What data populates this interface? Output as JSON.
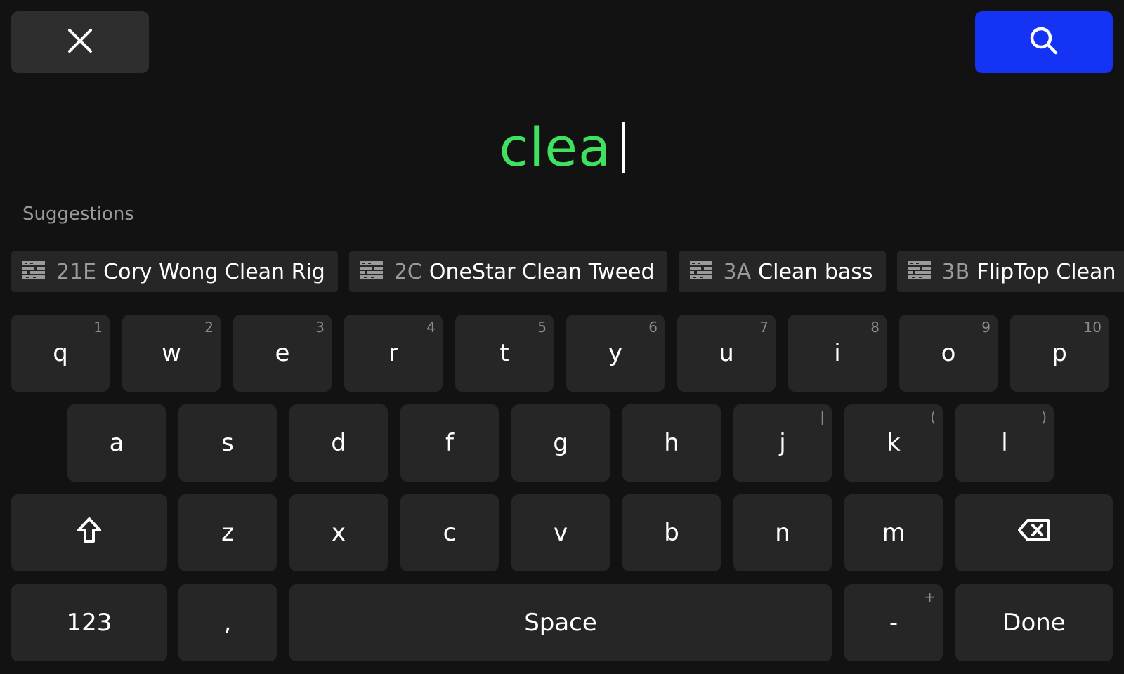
{
  "header": {
    "close_icon": "close-icon",
    "search_icon": "search-icon",
    "search_color": "#1433f5"
  },
  "query": {
    "text": "clea",
    "color": "#3fe15f"
  },
  "suggestions": {
    "label": "Suggestions",
    "items": [
      {
        "code": "21E",
        "name": "Cory Wong Clean Rig",
        "icon": "rig-icon"
      },
      {
        "code": "2C",
        "name": "OneStar Clean Tweed",
        "icon": "rig-icon"
      },
      {
        "code": "3A",
        "name": "Clean bass",
        "icon": "rig-icon"
      },
      {
        "code": "3B",
        "name": "FlipTop Clean",
        "icon": "rig-icon"
      }
    ]
  },
  "keyboard": {
    "row1": [
      {
        "label": "q",
        "hint": "1"
      },
      {
        "label": "w",
        "hint": "2"
      },
      {
        "label": "e",
        "hint": "3"
      },
      {
        "label": "r",
        "hint": "4"
      },
      {
        "label": "t",
        "hint": "5"
      },
      {
        "label": "y",
        "hint": "6"
      },
      {
        "label": "u",
        "hint": "7"
      },
      {
        "label": "i",
        "hint": "8"
      },
      {
        "label": "o",
        "hint": "9"
      },
      {
        "label": "p",
        "hint": "10"
      }
    ],
    "row2": [
      {
        "label": "a",
        "hint": ""
      },
      {
        "label": "s",
        "hint": ""
      },
      {
        "label": "d",
        "hint": ""
      },
      {
        "label": "f",
        "hint": ""
      },
      {
        "label": "g",
        "hint": ""
      },
      {
        "label": "h",
        "hint": ""
      },
      {
        "label": "j",
        "hint": "|"
      },
      {
        "label": "k",
        "hint": "("
      },
      {
        "label": "l",
        "hint": ")"
      }
    ],
    "row3": [
      {
        "label": "z",
        "hint": ""
      },
      {
        "label": "x",
        "hint": ""
      },
      {
        "label": "c",
        "hint": ""
      },
      {
        "label": "v",
        "hint": ""
      },
      {
        "label": "b",
        "hint": ""
      },
      {
        "label": "n",
        "hint": ""
      },
      {
        "label": "m",
        "hint": ""
      }
    ],
    "shift_icon": "shift-icon",
    "backspace_icon": "backspace-icon",
    "numbers_label": "123",
    "comma_label": ",",
    "space_label": "Space",
    "dash_label": "-",
    "dash_hint": "+",
    "done_label": "Done"
  }
}
